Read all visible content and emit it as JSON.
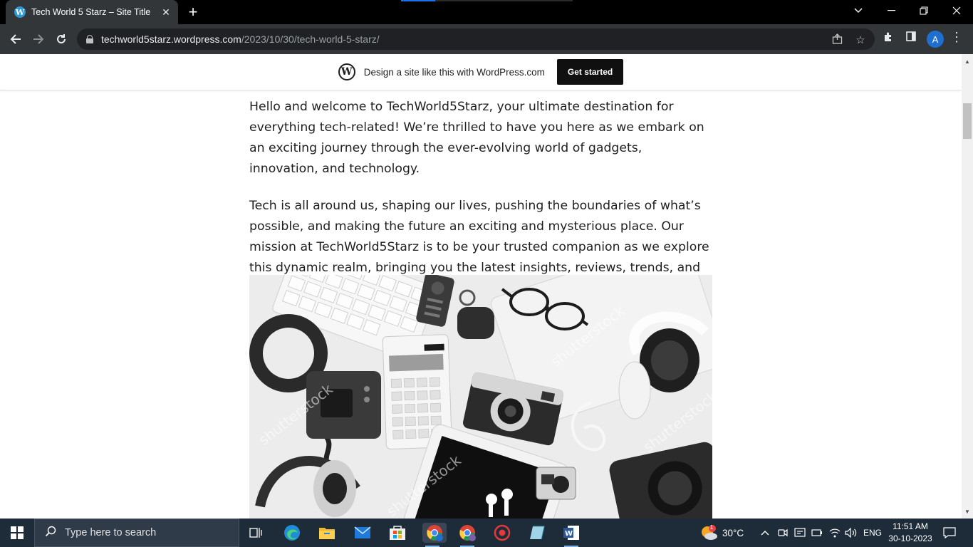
{
  "browser": {
    "tab_title": "Tech World 5 Starz – Site Title",
    "tab_favicon_letter": "W",
    "url_host": "techworld5starz.wordpress.com",
    "url_path": "/2023/10/30/tech-world-5-starz/",
    "profile_initial": "A"
  },
  "banner": {
    "text": "Design a site like this with WordPress.com",
    "button": "Get started",
    "logo_letter": "W"
  },
  "article": {
    "paragraphs": [
      "Hello and welcome to TechWorld5Starz, your ultimate destination for everything tech-related! We’re thrilled to have you here as we embark on an exciting journey through the ever-evolving world of gadgets, innovation, and technology.",
      "Tech is all around us, shaping our lives, pushing the boundaries of what’s possible, and making the future an exciting and mysterious place. Our mission at TechWorld5Starz is to be your trusted companion as we explore this dynamic realm, bringing you the latest insights, reviews, trends, and everything in between."
    ],
    "watermark": "shutterstock"
  },
  "taskbar": {
    "search_placeholder": "Type here to search",
    "weather_temp": "30°C",
    "weather_badge": "1",
    "language": "ENG",
    "time": "11:51 AM",
    "date": "30-10-2023"
  },
  "colors": {
    "tab_active": "#323639",
    "omnibox": "#202124",
    "banner_button": "#101010",
    "taskbar": "#1e2b38",
    "accent": "#1a73e8"
  }
}
